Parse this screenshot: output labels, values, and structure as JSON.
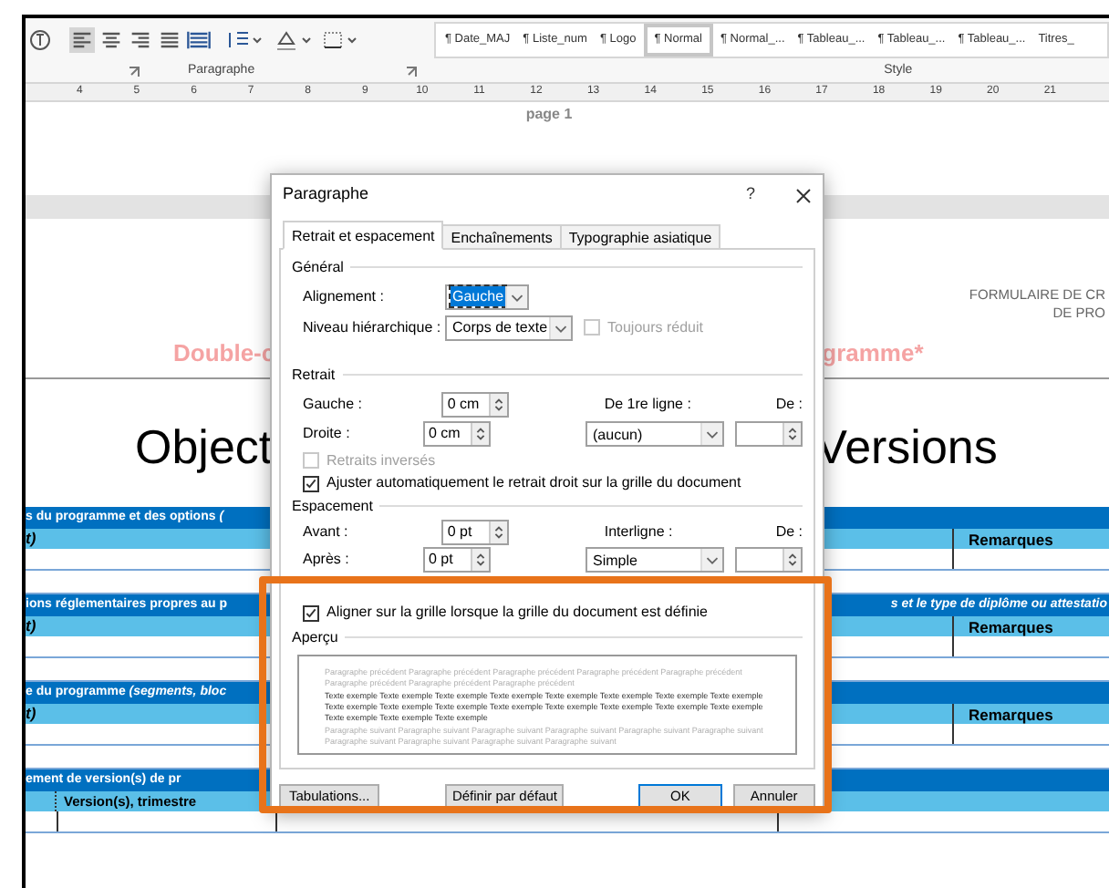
{
  "ribbon": {
    "styles": [
      {
        "label": "¶ Date_MAJ",
        "selected": false
      },
      {
        "label": "¶ Liste_num",
        "selected": false
      },
      {
        "label": "¶ Logo",
        "selected": false
      },
      {
        "label": "¶ Normal",
        "selected": true
      },
      {
        "label": "¶ Normal_...",
        "selected": false
      },
      {
        "label": "¶ Tableau_...",
        "selected": false
      },
      {
        "label": "¶ Tableau_...",
        "selected": false
      },
      {
        "label": "¶ Tableau_...",
        "selected": false
      },
      {
        "label": "Titres_",
        "selected": false
      }
    ],
    "groups": [
      "Paragraphe",
      "Style"
    ]
  },
  "ruler": {
    "marks": [
      "4",
      "5",
      "6",
      "7",
      "8",
      "9",
      "10",
      "11",
      "12",
      "13",
      "14",
      "15",
      "16",
      "17",
      "18",
      "19",
      "20",
      "21"
    ]
  },
  "document": {
    "page_label": "page 1",
    "header_right": [
      "FORMULAIRE DE CR",
      "DE PRO"
    ],
    "subtitle_left": "Double-c",
    "subtitle_right": "gramme*",
    "title_left": "Object",
    "title_right": "Versions",
    "sections": [
      {
        "heading": "s du programme et des options *(*",
        "subheading": "t)",
        "remarks": "Remarques"
      },
      {
        "heading": "ions réglementaires propres au p",
        "heading_right": "s et le type de diplôme ou attestatio",
        "subheading": "t)",
        "remarks": "Remarques"
      },
      {
        "heading": "e du programme *(segments, bloc*",
        "subheading": "t)",
        "remarks": "Remarques"
      },
      {
        "heading": "ement de version(s) de pr",
        "subheading": "Version(s), trimestre"
      }
    ]
  },
  "dialog": {
    "title": "Paragraphe",
    "help": "?",
    "tabs": [
      {
        "label": "Retrait et espacement",
        "selected": true
      },
      {
        "label": "Enchaînements",
        "selected": false
      },
      {
        "label": "Typographie asiatique",
        "selected": false
      }
    ],
    "general": {
      "title": "Général",
      "alignment": {
        "label": "Alignement :",
        "value": "Gauche",
        "focused": true
      },
      "outline": {
        "label": "Niveau hiérarchique :",
        "value": "Corps de texte",
        "focused": false
      },
      "collapsed": {
        "label": "Toujours réduit",
        "checked": false,
        "disabled": true
      }
    },
    "indent": {
      "title": "Retrait",
      "left": {
        "label": "Gauche :",
        "value": "0 cm"
      },
      "right": {
        "label": "Droite :",
        "value": "0 cm"
      },
      "special": {
        "label": "De 1re ligne :",
        "value": "(aucun)",
        "focused": false
      },
      "by": {
        "label": "De :"
      },
      "mirror": {
        "label": "Retraits inversés",
        "checked": false,
        "disabled": true
      },
      "auto_adjust": {
        "label": "Ajuster automatiquement le retrait droit sur la grille du document",
        "checked": true,
        "disabled": false
      }
    },
    "spacing": {
      "title": "Espacement",
      "before": {
        "label": "Avant :",
        "value": "0 pt"
      },
      "after": {
        "label": "Après :",
        "value": "0 pt"
      },
      "line": {
        "label": "Interligne :",
        "value": "Simple",
        "focused": false
      },
      "at": {
        "label": "De :"
      },
      "snap": {
        "label": "Aligner sur la grille lorsque la grille du document est définie",
        "checked": true,
        "disabled": false
      }
    },
    "preview": {
      "title": "Aperçu",
      "previous": "Paragraphe précédent Paragraphe précédent Paragraphe précédent Paragraphe précédent Paragraphe précédent Paragraphe précédent Paragraphe précédent Paragraphe précédent",
      "sample": "Texte exemple Texte exemple Texte exemple Texte exemple Texte exemple Texte exemple Texte exemple Texte exemple Texte exemple Texte exemple Texte exemple Texte exemple Texte exemple Texte exemple Texte exemple Texte exemple Texte exemple Texte exemple Texte exemple",
      "next": "Paragraphe suivant Paragraphe suivant Paragraphe suivant Paragraphe suivant Paragraphe suivant Paragraphe suivant Paragraphe suivant Paragraphe suivant Paragraphe suivant Paragraphe suivant"
    },
    "buttons": [
      "Tabulations...",
      "Définir par défaut",
      "OK",
      "Annuler"
    ]
  }
}
